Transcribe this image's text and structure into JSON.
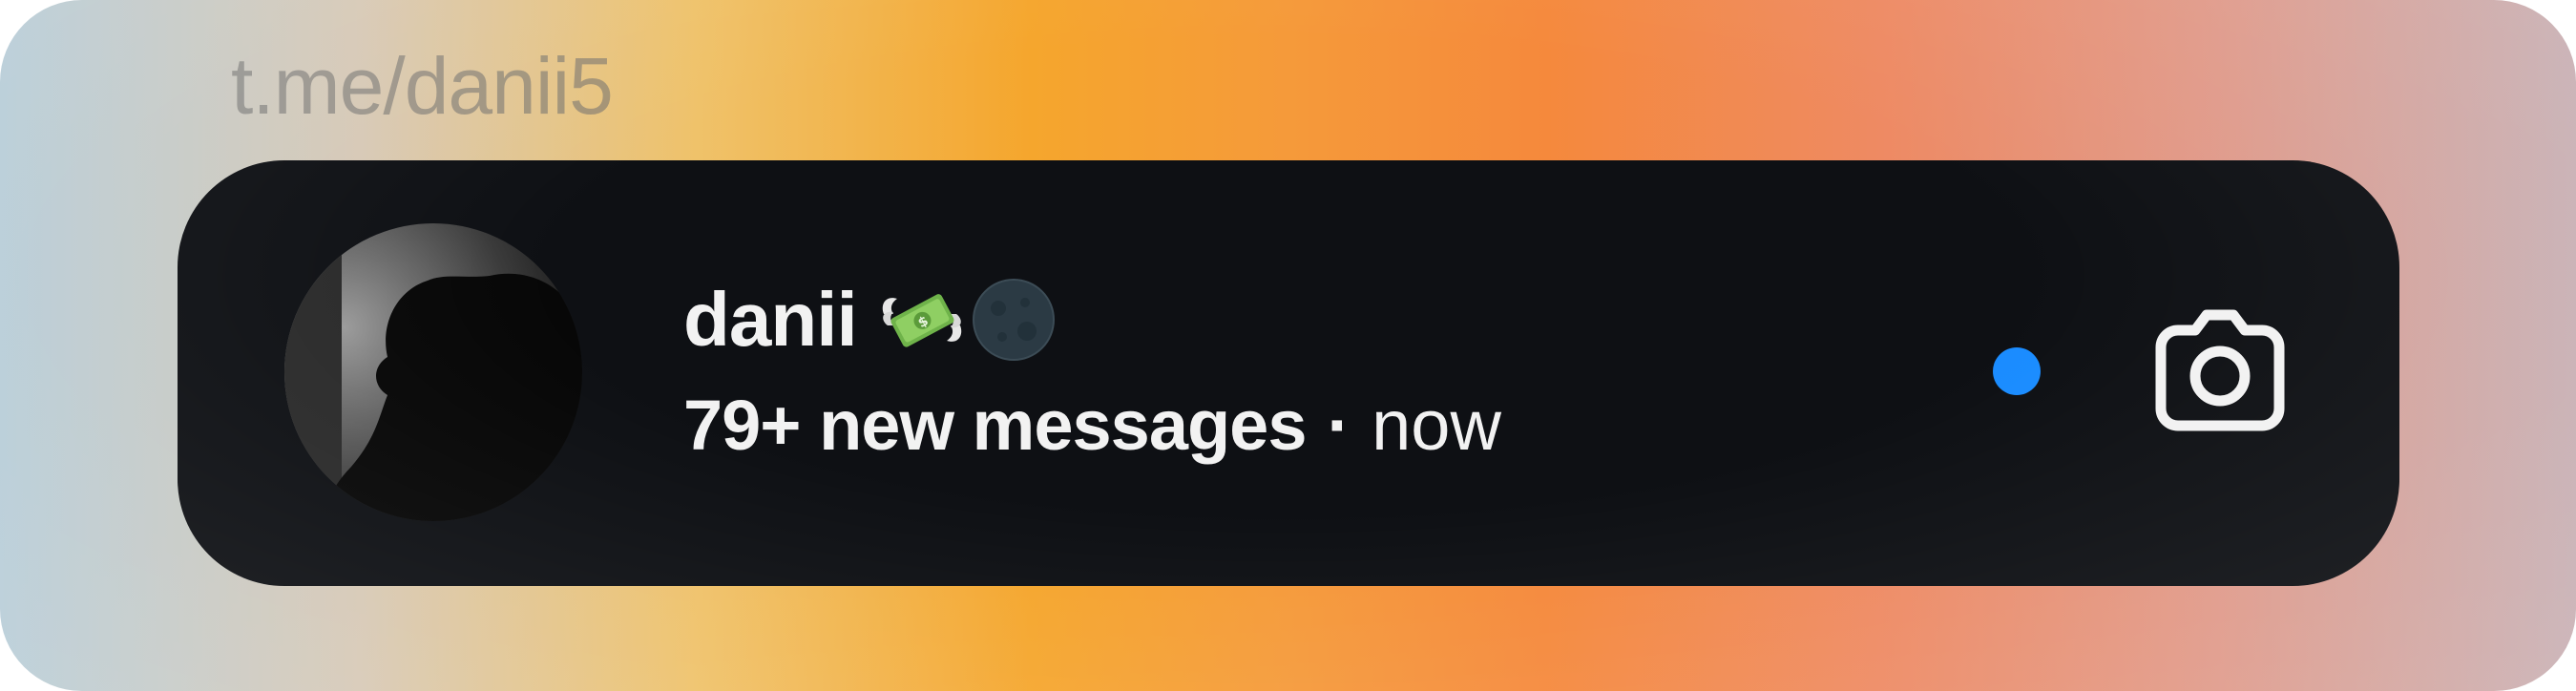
{
  "watermark": {
    "handle": "t.me/danii5"
  },
  "notification": {
    "sender_name": "danii",
    "sender_emojis": [
      "money-with-wings-emoji",
      "new-moon-emoji"
    ],
    "message_summary": "79+ new messages",
    "separator": "·",
    "timestamp": "now",
    "unread_indicator_color": "#1a8cff",
    "action_icon": "camera-icon"
  },
  "colors": {
    "toast_background": "#0e1014",
    "text_primary": "#f2f2f2",
    "accent_blue": "#1a8cff"
  }
}
